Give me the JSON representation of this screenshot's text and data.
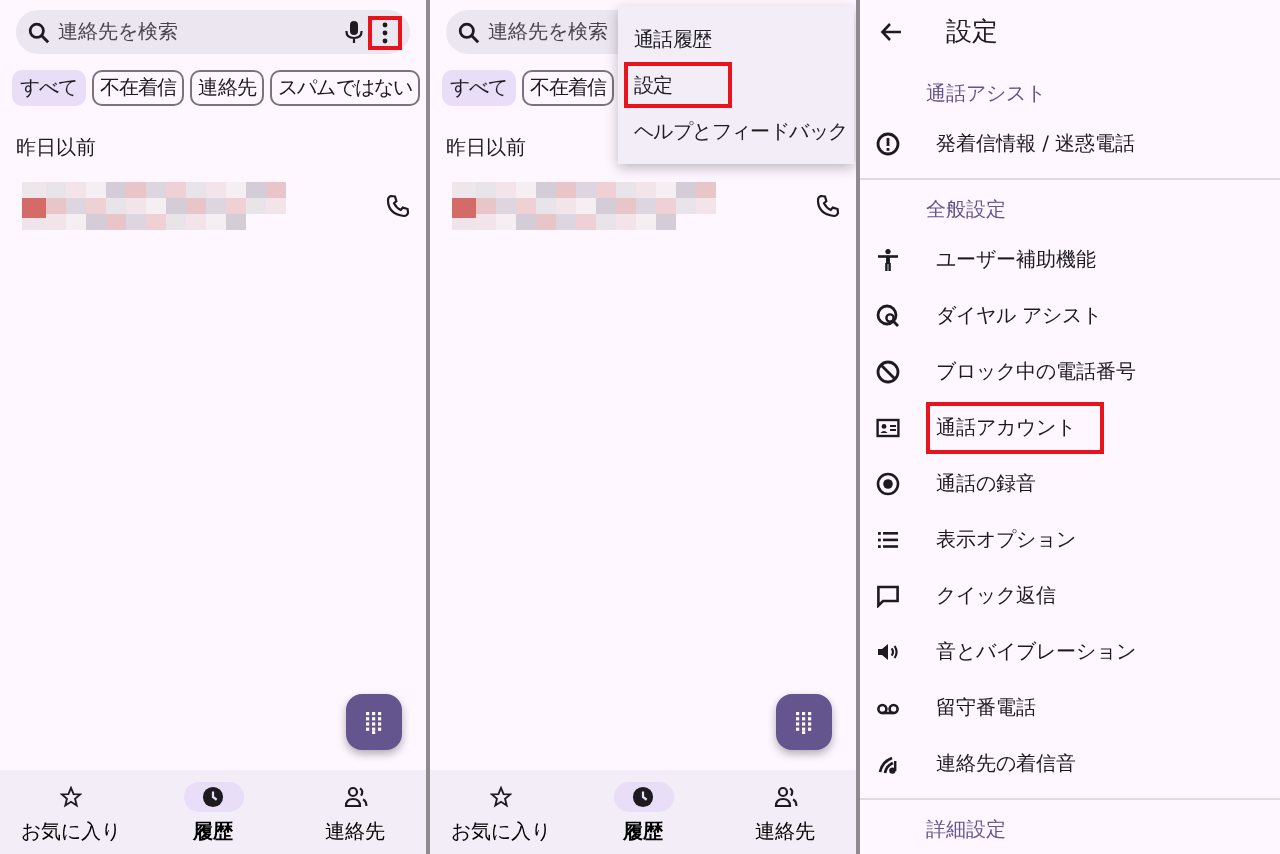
{
  "panels": [
    {
      "kind": "call_log",
      "search": {
        "placeholder": "連絡先を検索",
        "more_highlighted": true
      },
      "chips": [
        {
          "label": "すべて",
          "selected": true
        },
        {
          "label": "不在着信",
          "selected": false
        },
        {
          "label": "連絡先",
          "selected": false
        },
        {
          "label": "スパムではない",
          "selected": false
        }
      ],
      "section": "昨日以前",
      "nav": [
        {
          "label": "お気に入り",
          "selected": false
        },
        {
          "label": "履歴",
          "selected": true
        },
        {
          "label": "連絡先",
          "selected": false
        }
      ]
    },
    {
      "kind": "call_log",
      "search": {
        "placeholder": "連絡先を検索"
      },
      "chips": [
        {
          "label": "すべて",
          "selected": true
        },
        {
          "label": "不在着信",
          "selected": false
        }
      ],
      "section": "昨日以前",
      "menu": [
        {
          "label": "通話履歴",
          "highlighted": false
        },
        {
          "label": "設定",
          "highlighted": true
        },
        {
          "label": "ヘルプとフィードバック",
          "highlighted": false
        }
      ],
      "nav": [
        {
          "label": "お気に入り",
          "selected": false
        },
        {
          "label": "履歴",
          "selected": true
        },
        {
          "label": "連絡先",
          "selected": false
        }
      ]
    },
    {
      "kind": "settings",
      "title": "設定",
      "groups": [
        {
          "header": "通話アシスト",
          "items": [
            {
              "label": "発着信情報 / 迷惑電話",
              "highlighted": false
            }
          ]
        },
        {
          "header": "全般設定",
          "items": [
            {
              "label": "ユーザー補助機能",
              "highlighted": false
            },
            {
              "label": "ダイヤル アシスト",
              "highlighted": false
            },
            {
              "label": "ブロック中の電話番号",
              "highlighted": false
            },
            {
              "label": "通話アカウント",
              "highlighted": true
            },
            {
              "label": "通話の録音",
              "highlighted": false
            },
            {
              "label": "表示オプション",
              "highlighted": false
            },
            {
              "label": "クイック返信",
              "highlighted": false
            },
            {
              "label": "音とバイブレーション",
              "highlighted": false
            },
            {
              "label": "留守番電話",
              "highlighted": false
            },
            {
              "label": "連絡先の着信音",
              "highlighted": false
            }
          ]
        },
        {
          "header": "詳細設定"
        }
      ]
    }
  ]
}
